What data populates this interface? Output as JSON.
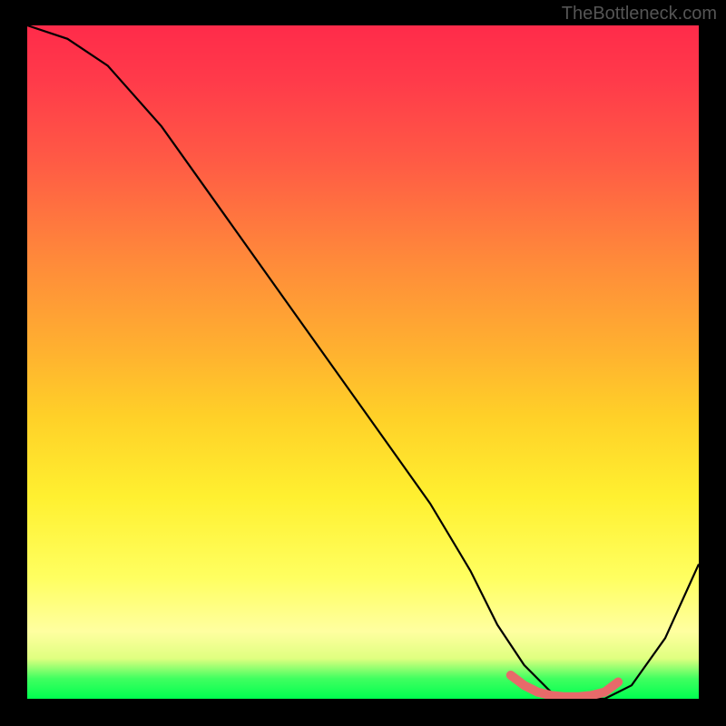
{
  "watermark": "TheBottleneck.com",
  "chart_data": {
    "type": "line",
    "title": "",
    "xlabel": "",
    "ylabel": "",
    "xlim": [
      0,
      100
    ],
    "ylim": [
      0,
      100
    ],
    "series": [
      {
        "name": "bottleneck-curve",
        "x": [
          0,
          6,
          12,
          20,
          30,
          40,
          50,
          60,
          66,
          70,
          74,
          78,
          82,
          86,
          90,
          95,
          100
        ],
        "values": [
          100,
          98,
          94,
          85,
          71,
          57,
          43,
          29,
          19,
          11,
          5,
          1,
          0,
          0,
          2,
          9,
          20
        ],
        "color": "#000000"
      },
      {
        "name": "optimal-marker",
        "x": [
          72,
          74,
          76,
          78,
          80,
          82,
          84,
          86,
          88
        ],
        "values": [
          3.5,
          2.0,
          1.0,
          0.5,
          0.3,
          0.3,
          0.5,
          1.0,
          2.5
        ],
        "color": "#e76a6a",
        "style": "thick"
      }
    ],
    "gradient_stops": [
      {
        "pos": 0,
        "color": "#ff2b4a"
      },
      {
        "pos": 50,
        "color": "#ffc030"
      },
      {
        "pos": 85,
        "color": "#ffff70"
      },
      {
        "pos": 100,
        "color": "#00ff50"
      }
    ]
  }
}
